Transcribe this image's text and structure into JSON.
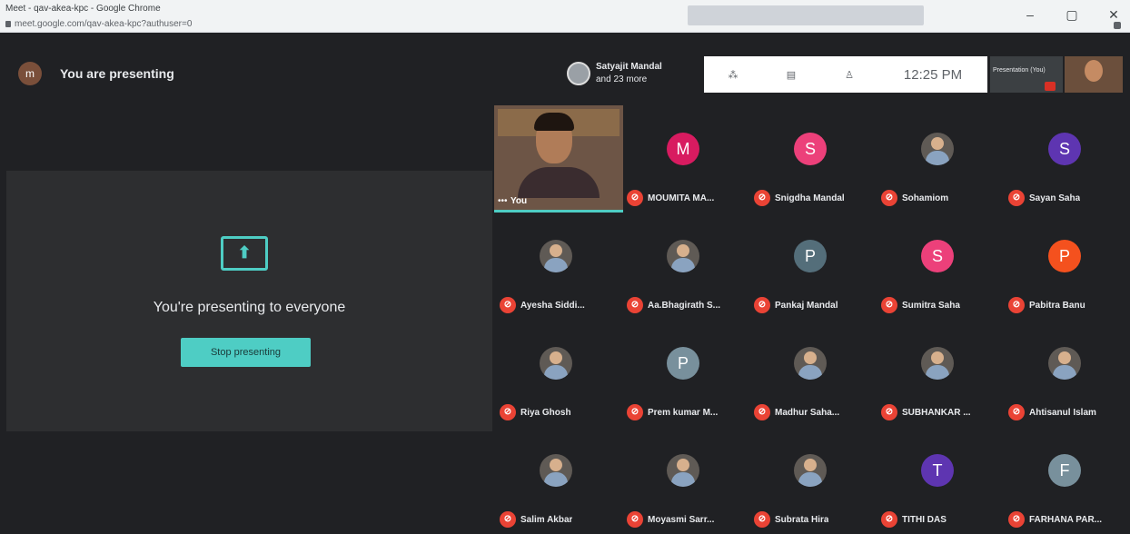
{
  "browser": {
    "tab_title": "Meet - qav-akea-kpc - Google Chrome",
    "url": "meet.google.com/qav-akea-kpc?authuser=0",
    "min": "–",
    "max": "▢",
    "close": "✕"
  },
  "header": {
    "user_initial": "m",
    "presenting_label": "You are presenting",
    "presenter_name": "Satyajit Mandal",
    "presenter_others": "and 23 more",
    "time": "12:25 PM",
    "presentation_label": "Presentation (You)",
    "icons": [
      "captions-icon",
      "chat-icon",
      "people-icon"
    ]
  },
  "presentation": {
    "message": "You're presenting to everyone",
    "stop_button": "Stop presenting"
  },
  "self_tile": {
    "label": "You"
  },
  "participants": [
    {
      "name": "MOUMITA MA...",
      "initial": "M",
      "color": "#d81b60",
      "photo": false
    },
    {
      "name": "Snigdha Mandal",
      "initial": "S",
      "color": "#ec407a",
      "photo": false
    },
    {
      "name": "Sohamiom",
      "initial": "",
      "color": "",
      "photo": true
    },
    {
      "name": "Sayan Saha",
      "initial": "S",
      "color": "#5e35b1",
      "photo": false
    },
    {
      "name": "Ayesha Siddi...",
      "initial": "",
      "color": "",
      "photo": true
    },
    {
      "name": "Aa.Bhagirath S...",
      "initial": "",
      "color": "",
      "photo": true
    },
    {
      "name": "Pankaj Mandal",
      "initial": "P",
      "color": "#546e7a",
      "photo": false
    },
    {
      "name": "Sumitra Saha",
      "initial": "S",
      "color": "#ec407a",
      "photo": false
    },
    {
      "name": "Pabitra Banu",
      "initial": "P",
      "color": "#f4511e",
      "photo": false
    },
    {
      "name": "Riya Ghosh",
      "initial": "",
      "color": "",
      "photo": true
    },
    {
      "name": "Prem kumar M...",
      "initial": "P",
      "color": "#78909c",
      "photo": false
    },
    {
      "name": "Madhur Saha...",
      "initial": "",
      "color": "",
      "photo": true
    },
    {
      "name": "SUBHANKAR ...",
      "initial": "",
      "color": "",
      "photo": true
    },
    {
      "name": "Ahtisanul Islam",
      "initial": "",
      "color": "",
      "photo": true
    },
    {
      "name": "Salim Akbar",
      "initial": "",
      "color": "",
      "photo": true
    },
    {
      "name": "Moyasmi Sarr...",
      "initial": "",
      "color": "",
      "photo": true
    },
    {
      "name": "Subrata Hira",
      "initial": "",
      "color": "",
      "photo": true
    },
    {
      "name": "TITHI DAS",
      "initial": "T",
      "color": "#5e35b1",
      "photo": false
    },
    {
      "name": "FARHANA PAR...",
      "initial": "F",
      "color": "#78909c",
      "photo": false
    }
  ],
  "mute_glyph": "🎙"
}
